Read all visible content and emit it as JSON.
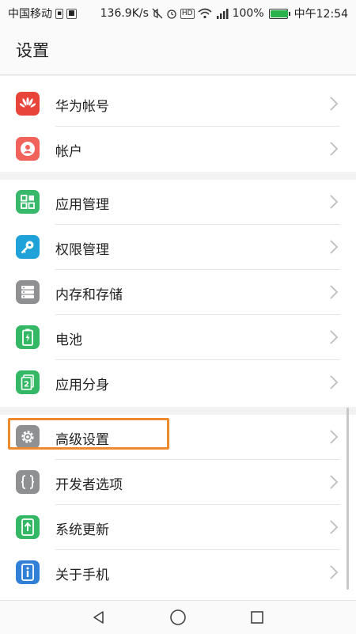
{
  "status_bar": {
    "carrier": "中国移动",
    "net_speed": "136.9K/s",
    "battery_percent": "100%",
    "time": "中午12:54",
    "icons": [
      "sim-icon",
      "notification-icon",
      "mute-icon",
      "alarm-icon",
      "hd-icon",
      "wifi-icon",
      "signal-icon",
      "battery-icon"
    ],
    "battery_level": 1.0
  },
  "header": {
    "title": "设置"
  },
  "groups": [
    {
      "items": [
        {
          "label": "华为帐号",
          "icon": "huawei-logo-icon",
          "color": "#e9443a"
        },
        {
          "label": "帐户",
          "icon": "account-icon",
          "color": "#f0625a"
        }
      ]
    },
    {
      "items": [
        {
          "label": "应用管理",
          "icon": "apps-grid-icon",
          "color": "#38b86a"
        },
        {
          "label": "权限管理",
          "icon": "key-icon",
          "color": "#1fa2d8"
        },
        {
          "label": "内存和存储",
          "icon": "storage-icon",
          "color": "#8e9092"
        },
        {
          "label": "电池",
          "icon": "battery-icon",
          "color": "#35b865"
        },
        {
          "label": "应用分身",
          "icon": "app-twin-icon",
          "color": "#35b865"
        }
      ]
    },
    {
      "items": [
        {
          "label": "高级设置",
          "icon": "gear-icon",
          "color": "#8e9092"
        },
        {
          "label": "开发者选项",
          "icon": "braces-icon",
          "color": "#8e9092"
        },
        {
          "label": "系统更新",
          "icon": "system-update-icon",
          "color": "#35b865"
        },
        {
          "label": "关于手机",
          "icon": "info-icon",
          "color": "#2f80d6"
        }
      ]
    }
  ],
  "colors": {
    "highlight": "#f0882e",
    "background": "#f2f2f2"
  },
  "nav": {
    "icons": [
      "back-icon",
      "home-icon",
      "recents-icon"
    ]
  }
}
